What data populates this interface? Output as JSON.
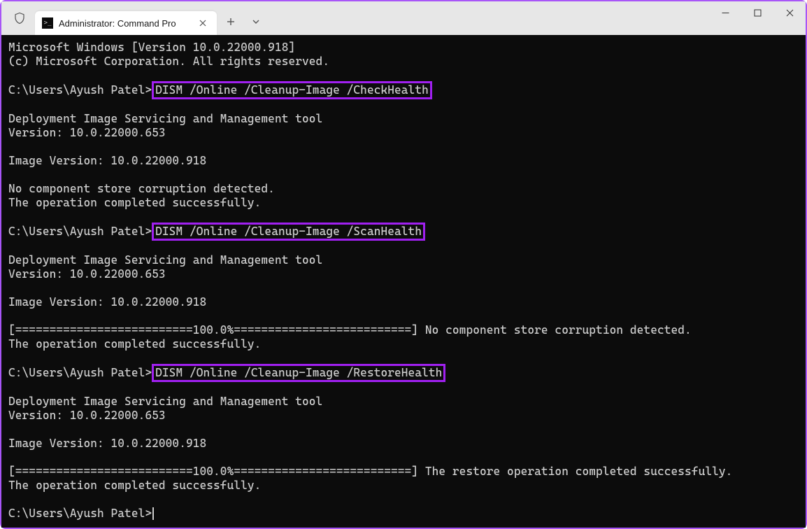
{
  "window": {
    "tab_title": "Administrator: Command Pro",
    "tab_icon_glyph": ">_"
  },
  "terminal": {
    "header_line1": "Microsoft Windows [Version 10.0.22000.918]",
    "header_line2": "(c) Microsoft Corporation. All rights reserved.",
    "prompt": "C:\\Users\\Ayush Patel>",
    "cmd1": "DISM /Online /Cleanup-Image /CheckHealth",
    "cmd2": "DISM /Online /Cleanup-Image /ScanHealth",
    "cmd3": "DISM /Online /Cleanup-Image /RestoreHealth",
    "dism_title": "Deployment Image Servicing and Management tool",
    "dism_version": "Version: 10.0.22000.653",
    "image_version": "Image Version: 10.0.22000.918",
    "no_corruption": "No component store corruption detected.",
    "op_success": "The operation completed successfully.",
    "progress_no_corruption": "[==========================100.0%==========================] No component store corruption detected.",
    "progress_restore": "[==========================100.0%==========================] The restore operation completed successfully."
  }
}
